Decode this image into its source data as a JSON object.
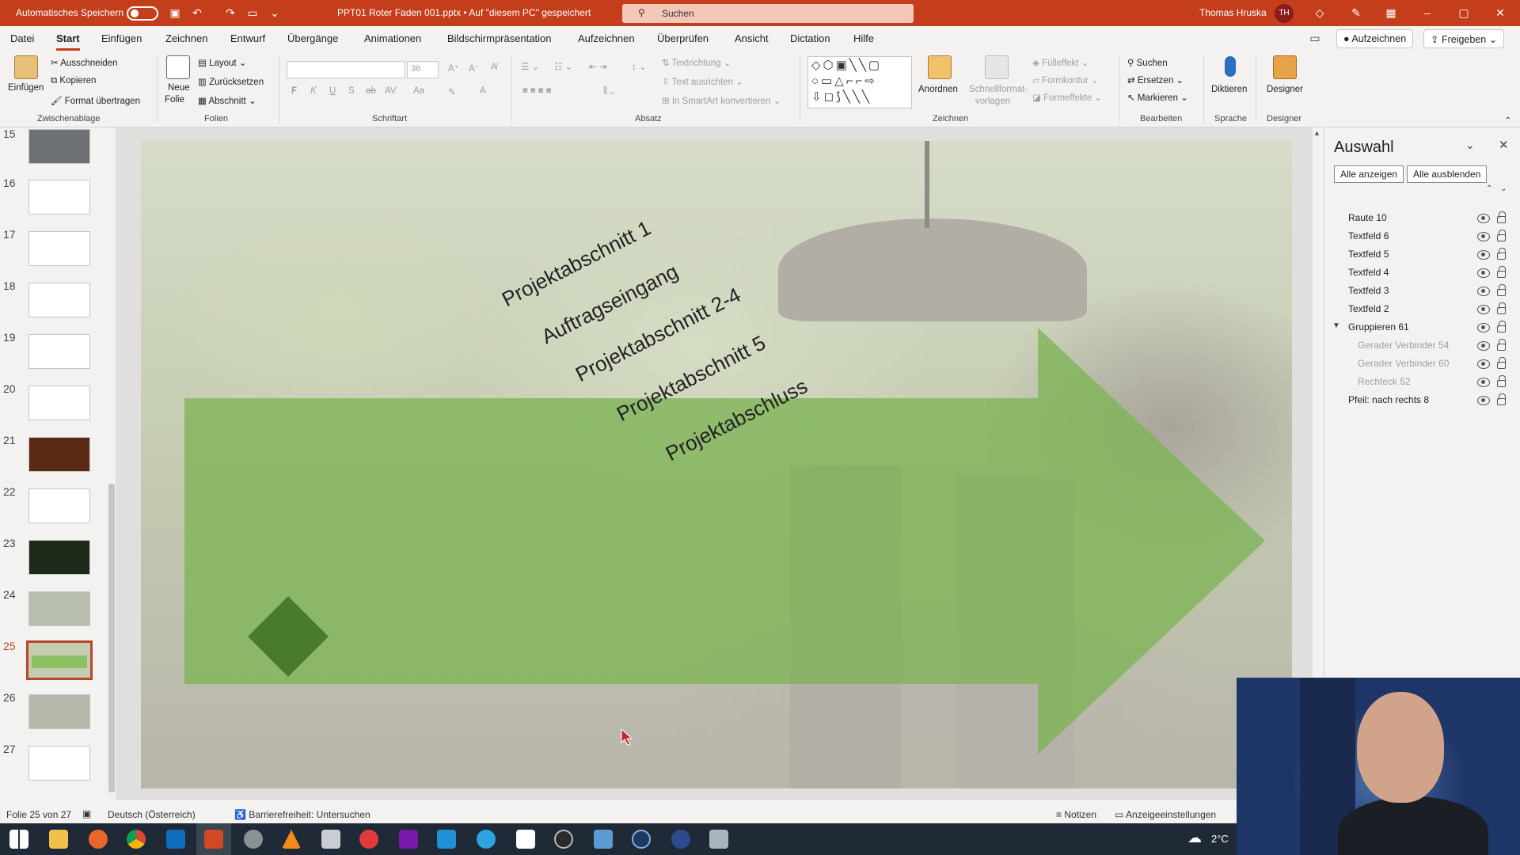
{
  "titlebar": {
    "autosave_label": "Automatisches Speichern",
    "file_title": "PPT01 Roter Faden 001.pptx  •  Auf \"diesem PC\" gespeichert",
    "search_placeholder": "Suchen",
    "user_name": "Thomas Hruska",
    "user_initials": "TH"
  },
  "menu": {
    "tabs": [
      "Datei",
      "Start",
      "Einfügen",
      "Zeichnen",
      "Entwurf",
      "Übergänge",
      "Animationen",
      "Bildschirmpräsentation",
      "Aufzeichnen",
      "Überprüfen",
      "Ansicht",
      "Dictation",
      "Hilfe"
    ],
    "record_button": "Aufzeichnen",
    "share_button": "Freigeben"
  },
  "ribbon": {
    "clipboard": {
      "paste": "Einfügen",
      "cut": "Ausschneiden",
      "copy": "Kopieren",
      "format_painter": "Format übertragen",
      "group": "Zwischenablage"
    },
    "slides": {
      "new_slide_1": "Neue",
      "new_slide_2": "Folie",
      "layout": "Layout",
      "reset": "Zurücksetzen",
      "section": "Abschnitt",
      "group": "Folien"
    },
    "font": {
      "size": "36",
      "bold": "F",
      "italic": "K",
      "underline": "U",
      "shadow": "S",
      "strike": "ab",
      "spacing": "AV",
      "case": "Aa",
      "group": "Schriftart"
    },
    "paragraph": {
      "text_direction": "Textrichtung",
      "align_text": "Text ausrichten",
      "smartart": "In SmartArt konvertieren",
      "group": "Absatz"
    },
    "drawing": {
      "arrange": "Anordnen",
      "quick_styles_1": "Schnellformat-",
      "quick_styles_2": "vorlagen",
      "fill": "Fülleffekt",
      "outline": "Formkontur",
      "effects": "Formeffekte",
      "group": "Zeichnen"
    },
    "editing": {
      "find": "Suchen",
      "replace": "Ersetzen",
      "select": "Markieren",
      "group": "Bearbeiten"
    },
    "voice": {
      "dictate": "Diktieren",
      "group": "Sprache"
    },
    "designer": {
      "label": "Designer",
      "group": "Designer"
    }
  },
  "thumbnails": [
    "15",
    "16",
    "17",
    "18",
    "19",
    "20",
    "21",
    "22",
    "23",
    "24",
    "25",
    "26",
    "27"
  ],
  "slide": {
    "labels": [
      "Projektabschnitt 1",
      "Auftragseingang",
      "Projektabschnitt 2-4",
      "Projektabschnitt 5",
      "Projektabschluss"
    ]
  },
  "selection_pane": {
    "title": "Auswahl",
    "show_all": "Alle anzeigen",
    "hide_all": "Alle ausblenden",
    "items": [
      "Raute 10",
      "Textfeld 6",
      "Textfeld 5",
      "Textfeld 4",
      "Textfeld 3",
      "Textfeld 2",
      "Gruppieren 61",
      "Gerader Verbinder 54",
      "Gerader Verbinder 60",
      "Rechteck 52",
      "Pfeil: nach rechts 8"
    ]
  },
  "statusbar": {
    "slide_info": "Folie 25 von 27",
    "language": "Deutsch (Österreich)",
    "accessibility": "Barrierefreiheit: Untersuchen",
    "notes": "Notizen",
    "display_settings": "Anzeigeeinstellungen"
  },
  "taskbar": {
    "weather": "2°C"
  },
  "colors": {
    "accent": "#c43e1c",
    "arrow_green": "#7db455",
    "diamond_green": "#4a7a2e"
  }
}
